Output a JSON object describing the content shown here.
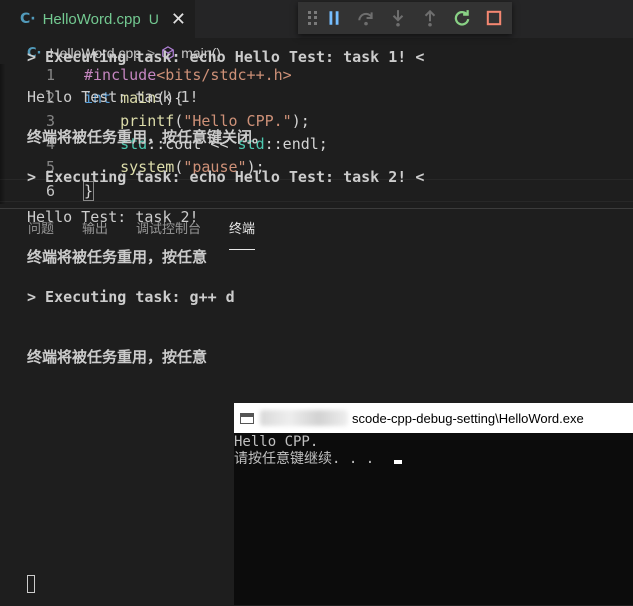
{
  "tab": {
    "filename": "HelloWord.cpp",
    "status": "U",
    "close": "✕"
  },
  "breadcrumb": {
    "file": "HelloWord.cpp",
    "separator": ">",
    "symbol": "main()"
  },
  "editor": {
    "line_numbers": [
      "1",
      "2",
      "3",
      "4",
      "5",
      "6"
    ],
    "lines": [
      {
        "parts": [
          {
            "t": "#include",
            "c": "pp"
          },
          {
            "t": "<bits/stdc++.h>",
            "c": "str"
          }
        ]
      },
      {
        "parts": [
          {
            "t": "int",
            "c": "kw"
          },
          {
            "t": " ",
            "c": "pl"
          },
          {
            "t": "main",
            "c": "fn"
          },
          {
            "t": "(){",
            "c": "pl"
          }
        ]
      },
      {
        "parts": [
          {
            "t": "    ",
            "c": "pl"
          },
          {
            "t": "printf",
            "c": "fn"
          },
          {
            "t": "(",
            "c": "pl"
          },
          {
            "t": "\"Hello CPP.\"",
            "c": "str"
          },
          {
            "t": ");",
            "c": "pl"
          }
        ]
      },
      {
        "parts": [
          {
            "t": "    ",
            "c": "pl"
          },
          {
            "t": "std",
            "c": "ns"
          },
          {
            "t": "::cout << ",
            "c": "pl"
          },
          {
            "t": "std",
            "c": "ns"
          },
          {
            "t": "::endl;",
            "c": "pl"
          }
        ]
      },
      {
        "parts": [
          {
            "t": "    ",
            "c": "pl"
          },
          {
            "t": "system",
            "c": "fn"
          },
          {
            "t": "(",
            "c": "pl"
          },
          {
            "t": "\"pause\"",
            "c": "str"
          },
          {
            "t": ");",
            "c": "pl"
          }
        ]
      },
      {
        "parts": [
          {
            "t": "}",
            "c": "brk"
          }
        ]
      }
    ]
  },
  "debug_toolbar": {
    "icons": [
      "pause-icon",
      "step-over-icon",
      "step-into-icon",
      "step-out-icon",
      "restart-icon",
      "stop-icon"
    ],
    "colors": {
      "pause": "#75beff",
      "disabled": "#6e6e6e",
      "restart": "#89d185",
      "stop": "#f48771"
    }
  },
  "panel": {
    "tabs": [
      "问题",
      "输出",
      "调试控制台",
      "终端"
    ],
    "active_tab": "终端"
  },
  "terminal": {
    "lines": [
      {
        "text": "> Executing task: echo Hello Test: task 1! <",
        "bold": true
      },
      {
        "text": "Hello Test: task 1!",
        "bold": false
      },
      {
        "text": "终端将被任务重用，按任意键关闭。",
        "bold": true
      },
      {
        "text": "> Executing task: echo Hello Test: task 2! <",
        "bold": true
      },
      {
        "text": "Hello Test: task 2!",
        "bold": false
      },
      {
        "text": "终端将被任务重用，按任意",
        "bold": true
      },
      {
        "text": "> Executing task: g++ d",
        "bold": true
      },
      {
        "text": "终端将被任务重用，按任意",
        "bold": true
      }
    ]
  },
  "console_window": {
    "title": "scode-cpp-debug-setting\\HelloWord.exe",
    "lines": [
      "Hello CPP.",
      "请按任意键继续. . ."
    ]
  }
}
